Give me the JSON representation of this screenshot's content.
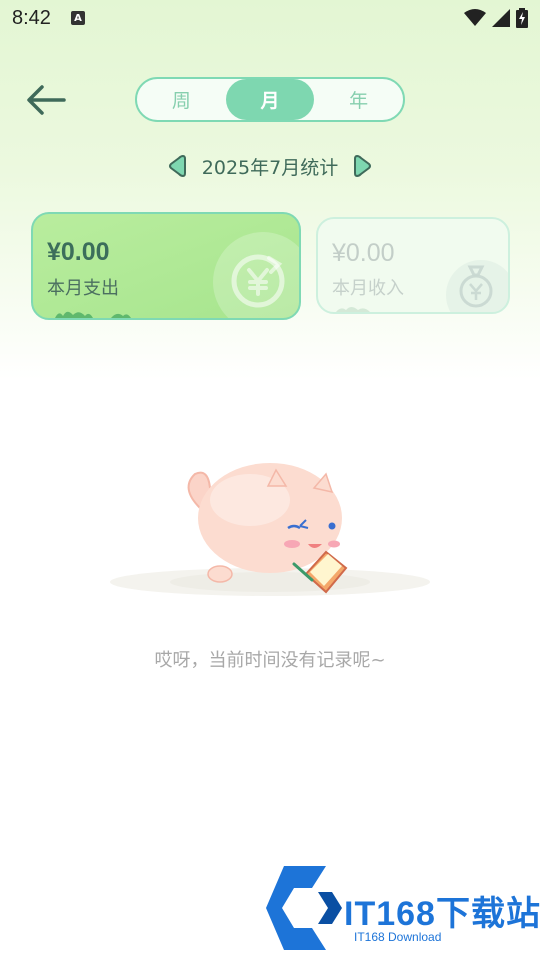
{
  "status_bar": {
    "time": "8:42",
    "notification_badge": "A",
    "icons": [
      "wifi-icon",
      "signal-icon",
      "battery-charging-icon"
    ]
  },
  "header": {
    "back_icon": "arrow-left-icon",
    "tabs": [
      {
        "label": "周",
        "active": false
      },
      {
        "label": "月",
        "active": true
      },
      {
        "label": "年",
        "active": false
      }
    ]
  },
  "month_nav": {
    "label": "2025年7月统计",
    "prev_icon": "triangle-left-icon",
    "next_icon": "triangle-right-icon"
  },
  "summary": {
    "expense": {
      "amount": "¥0.00",
      "caption": "本月支出",
      "selected": true
    },
    "income": {
      "amount": "¥0.00",
      "caption": "本月收入",
      "selected": false
    }
  },
  "empty_state": {
    "message": "哎呀，当前时间没有记录呢~",
    "illustration": "cat-mascot-illustration"
  },
  "watermark": {
    "title": "IT168下载站",
    "subtitle": "IT168 Download"
  },
  "colors": {
    "accent": "#7ed7b0",
    "accent_border": "#7fd9b4",
    "expense_card": "#b9ed9e",
    "text_dark_green": "#3f6a5a",
    "watermark_blue": "#1d74d8"
  }
}
